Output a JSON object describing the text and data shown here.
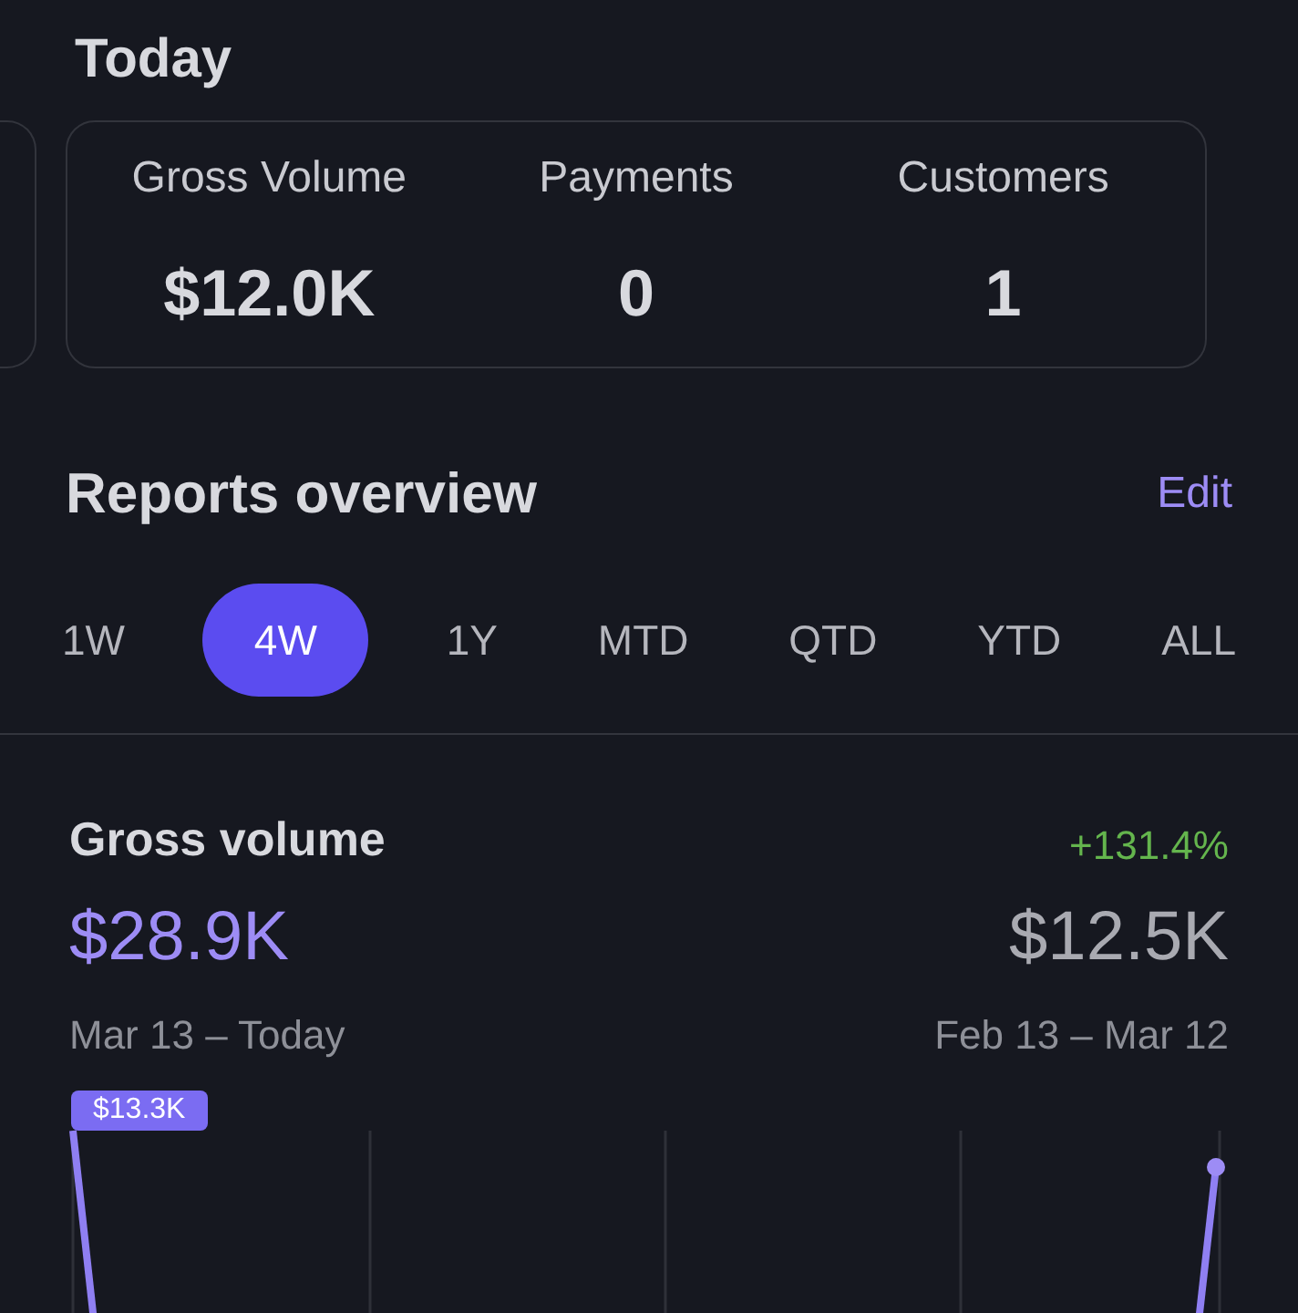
{
  "today": {
    "title": "Today",
    "stats": [
      {
        "label": "Gross Volume",
        "value": "$12.0K"
      },
      {
        "label": "Payments",
        "value": "0"
      },
      {
        "label": "Customers",
        "value": "1"
      }
    ]
  },
  "reports": {
    "title": "Reports overview",
    "edit": "Edit",
    "ranges": [
      {
        "label": "1W",
        "selected": false
      },
      {
        "label": "4W",
        "selected": true
      },
      {
        "label": "1Y",
        "selected": false
      },
      {
        "label": "MTD",
        "selected": false
      },
      {
        "label": "QTD",
        "selected": false
      },
      {
        "label": "YTD",
        "selected": false
      },
      {
        "label": "ALL",
        "selected": false
      }
    ]
  },
  "gross_volume": {
    "title": "Gross volume",
    "change": "+131.4%",
    "current_value": "$28.9K",
    "previous_value": "$12.5K",
    "current_period": "Mar 13 – Today",
    "previous_period": "Feb 13 – Mar 12",
    "chart_tooltip": "$13.3K"
  }
}
